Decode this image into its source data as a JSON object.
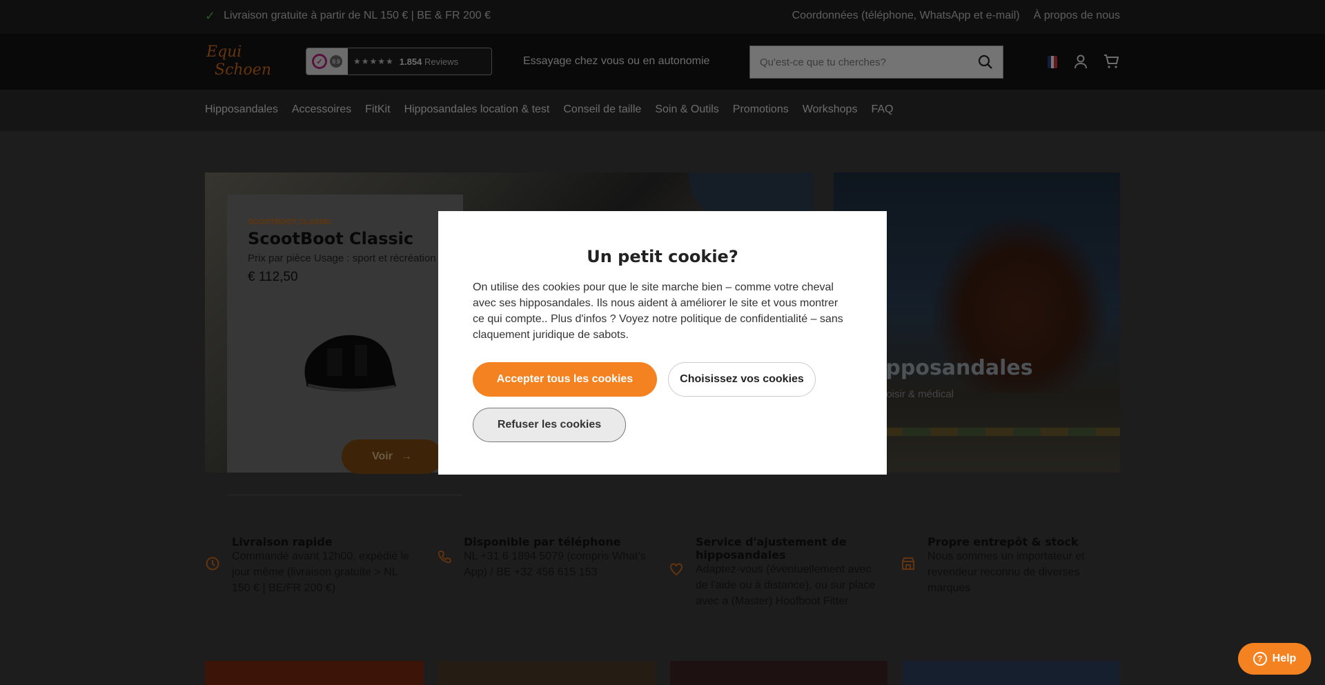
{
  "topbar": {
    "shipping": "Livraison gratuite à partir de NL 150 € | BE & FR 200 €",
    "contact": "Coordonnées (téléphone, WhatsApp et e-mail)",
    "about": "À propos de nous"
  },
  "header": {
    "logo_line1": "Equi",
    "logo_line2": "Schoen",
    "review_score": "9.9",
    "review_count": "1.854",
    "review_label": "Reviews",
    "tryon": "Essayage chez vous ou en autonomie",
    "search_placeholder": "Qu'est-ce que tu cherches?"
  },
  "nav": {
    "items": [
      "Hipposandales",
      "Accessoires",
      "FitKit",
      "Hipposandales location & test",
      "Conseil de taille",
      "Soin & Outils",
      "Promotions",
      "Workshops",
      "FAQ"
    ]
  },
  "hero": {
    "card_kicker": "SCOOTBOOT CLASSIC",
    "card_title": "ScootBoot Classic",
    "card_sub": "Prix par pièce Usage : sport et récréation",
    "card_price": "€ 112,50",
    "card_button": "Voir",
    "right_title": "Hipposandales",
    "right_sub": "Loisir & médical"
  },
  "usps": [
    {
      "title": "Livraison rapide",
      "text": "Commandé avant 12h00, expédié le jour même (livraison gratuite > NL 150 € | BE/FR 200 €)"
    },
    {
      "title": "Disponible par téléphone",
      "text": "NL +31 6 1894 5079 (compris What's App) / BE +32 456 615 153"
    },
    {
      "title": "Service d'ajustement de hipposandales",
      "text": "Adaptez-vous (éventuellement avec de l'aide ou à distance), ou sur place avec a (Master) Hoofboot Fitter"
    },
    {
      "title": "Propre entrepôt & stock",
      "text": "Nous sommes un importateur et revendeur reconnu de diverses marques"
    }
  ],
  "cookie": {
    "title": "Un petit cookie?",
    "body": "On utilise des cookies pour que le site marche bien – comme votre cheval avec ses hipposandales. Ils nous aident à améliorer le site et vous montrer ce qui compte.. Plus d'infos ? Voyez notre politique de confidentialité – sans claquement juridique de sabots.",
    "accept": "Accepter tous les cookies",
    "choose": "Choisissez vos cookies",
    "refuse": "Refuser les cookies"
  },
  "help": {
    "label": "Help"
  },
  "colors": {
    "accent": "#f58220",
    "brand_orange": "#c8691d",
    "overlay": "rgba(0,0,0,0.5)"
  },
  "icons": [
    "check-icon",
    "search-icon",
    "user-icon",
    "cart-icon",
    "clock-icon",
    "phone-icon",
    "heart-icon",
    "store-icon",
    "arrow-right-icon",
    "help-icon"
  ]
}
